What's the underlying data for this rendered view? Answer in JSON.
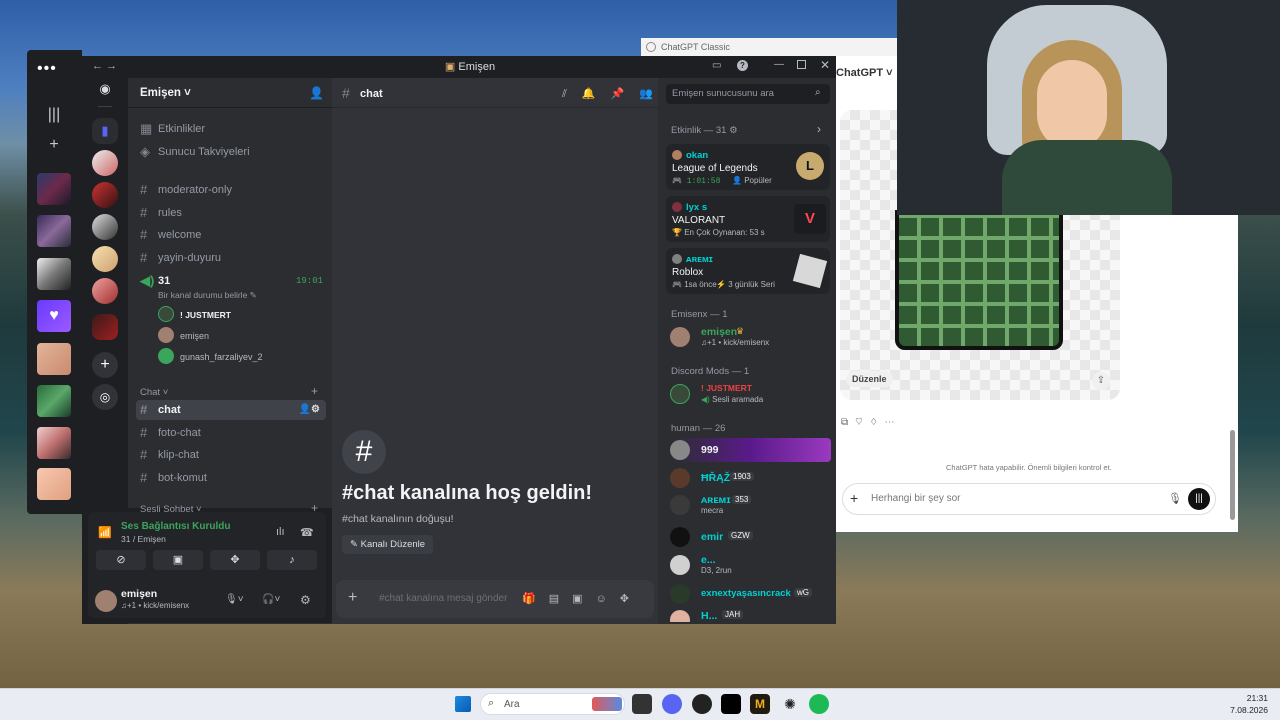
{
  "window": {
    "title": "Emişen"
  },
  "server": {
    "name": "Emişen"
  },
  "channels": {
    "top": [
      {
        "label": "Etkinlikler"
      },
      {
        "label": "Sunucu Takviyeleri"
      }
    ],
    "text": [
      {
        "label": "moderator-only"
      },
      {
        "label": "rules"
      },
      {
        "label": "welcome"
      },
      {
        "label": "yayin-duyuru"
      }
    ],
    "voice": {
      "name": "31",
      "time": "19:01",
      "status": "Bir kanal durumu belirle",
      "users": [
        "! JUSTMERT",
        "emişen",
        "gunash_farzaliyev_2"
      ]
    },
    "chat_category": "Chat",
    "chat": [
      {
        "label": "chat"
      },
      {
        "label": "foto-chat"
      },
      {
        "label": "klip-chat"
      },
      {
        "label": "bot-komut"
      }
    ],
    "voice_category": "Sesli Sohbet"
  },
  "voice_panel": {
    "status": "Ses Bağlantısı Kuruldu",
    "channel": "31 / Emişen"
  },
  "user": {
    "name": "emişen",
    "status": "♫+1 • kick/emisenx"
  },
  "chat": {
    "channel": "chat",
    "welcome": "#chat kanalına hoş geldin!",
    "subtitle": "#chat kanalının doğuşu!",
    "edit_label": "Kanalı Düzenle",
    "placeholder": "#chat kanalına mesaj gönder"
  },
  "members": {
    "search_placeholder": "Emişen sunucusunu ara",
    "activity_header": "Etkinlik — 31",
    "activities": [
      {
        "user": "okan",
        "game": "League of Legends",
        "detail": "1:01:58",
        "extra": "Popüler",
        "color": "#3ba55c"
      },
      {
        "user": "lyx s",
        "game": "VALORANT",
        "detail": "En Çok Oynanan: 53 s",
        "extra": "",
        "color": "#ff4655"
      },
      {
        "user": "ᴀʀᴇᴍɪ",
        "game": "Roblox",
        "detail": "1sa önce",
        "extra": "3 günlük Seri",
        "color": "#dbdee1"
      }
    ],
    "groups": [
      {
        "header": "Emisenx — 1",
        "members": [
          {
            "name": "emişen",
            "sub": "♫+1 • kick/emisenx",
            "color": "#3ba55c"
          }
        ]
      },
      {
        "header": "Discord Mods — 1",
        "members": [
          {
            "name": "! JUSTMERT",
            "sub": "Sesli aramada",
            "color": "#ed4245"
          }
        ]
      },
      {
        "header": "human — 26",
        "members": [
          {
            "name": "999",
            "sub": "",
            "color": "#f2f3f5",
            "tag": ""
          },
          {
            "name": "ĦŘĄŽ",
            "sub": "",
            "color": "#00d1d1",
            "tag": "1903"
          },
          {
            "name": "ᴀʀᴇᴍɪ",
            "sub": "mecra",
            "color": "#00d1d1",
            "tag": "353"
          },
          {
            "name": "emir",
            "sub": "",
            "color": "#00d1d1",
            "tag": "GZW"
          },
          {
            "name": "e...",
            "sub": "D3, 2run",
            "color": "#00d1d1",
            "tag": ""
          },
          {
            "name": "exnextyaşasıncrack",
            "sub": "",
            "color": "#00d1d1",
            "tag": "wG"
          },
          {
            "name": "H...",
            "sub": "",
            "color": "#00d1d1",
            "tag": "JAH"
          }
        ]
      }
    ]
  },
  "chatgpt": {
    "tab": "ChatGPT Classic",
    "model": "ChatGPT",
    "edit": "Düzenle",
    "disclaimer": "ChatGPT hata yapabilir. Önemli bilgileri kontrol et.",
    "input_placeholder": "Herhangi bir şey sor"
  },
  "taskbar": {
    "search": "Ara",
    "time": "21:31",
    "date": "7.08.2026"
  }
}
